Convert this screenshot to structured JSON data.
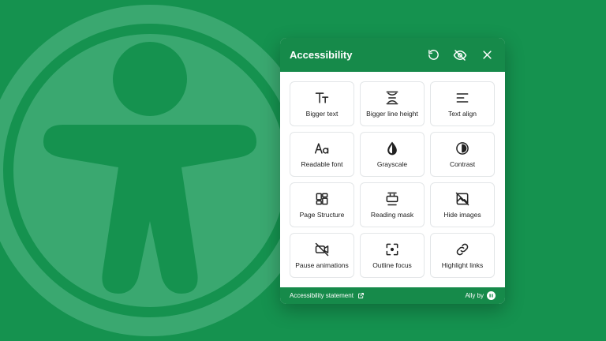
{
  "colors": {
    "background": "#15924f",
    "header": "#168a4a",
    "logo_tint": "#3aa870"
  },
  "header": {
    "title": "Accessibility",
    "icons": [
      "reset-icon",
      "hide-widget-icon",
      "close-icon"
    ]
  },
  "tiles": [
    {
      "label": "Bigger text",
      "icon": "text-size-icon"
    },
    {
      "label": "Bigger line height",
      "icon": "line-height-icon"
    },
    {
      "label": "Text align",
      "icon": "text-align-icon"
    },
    {
      "label": "Readable font",
      "icon": "readable-font-icon"
    },
    {
      "label": "Grayscale",
      "icon": "grayscale-icon"
    },
    {
      "label": "Contrast",
      "icon": "contrast-icon"
    },
    {
      "label": "Page Structure",
      "icon": "page-structure-icon"
    },
    {
      "label": "Reading mask",
      "icon": "reading-mask-icon"
    },
    {
      "label": "Hide images",
      "icon": "hide-images-icon"
    },
    {
      "label": "Pause animations",
      "icon": "pause-animations-icon"
    },
    {
      "label": "Outline focus",
      "icon": "outline-focus-icon"
    },
    {
      "label": "Highlight links",
      "icon": "highlight-links-icon"
    }
  ],
  "footer": {
    "statement_label": "Accessibility statement",
    "brand_label": "Ally by"
  }
}
